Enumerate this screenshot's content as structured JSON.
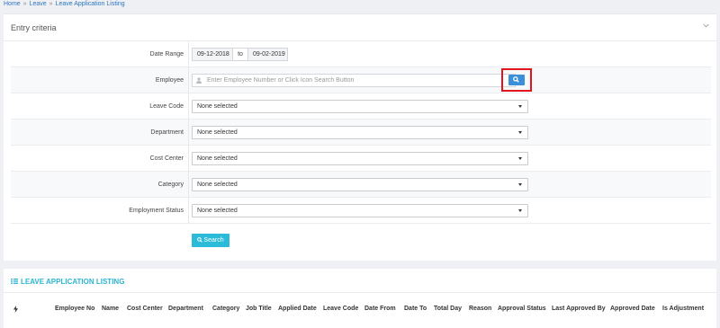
{
  "breadcrumb": {
    "home": "Home",
    "leave": "Leave",
    "current": "Leave Application Listing",
    "separator": "»"
  },
  "entry": {
    "title": "Entry criteria",
    "date_range": {
      "label": "Date Range",
      "from": "09-12-2018",
      "to_label": "to",
      "to": "09-02-2019"
    },
    "employee": {
      "label": "Employee",
      "placeholder": "Enter Employee Number or Click Icon Search Button"
    },
    "leave_code": {
      "label": "Leave Code",
      "value": "None selected"
    },
    "department": {
      "label": "Department",
      "value": "None selected"
    },
    "cost_center": {
      "label": "Cost Center",
      "value": "None selected"
    },
    "category": {
      "label": "Category",
      "value": "None selected"
    },
    "employment_status": {
      "label": "Employment Status",
      "value": "None selected"
    },
    "search_label": "Search"
  },
  "listing": {
    "title": "LEAVE APPLICATION LISTING",
    "columns": [
      "Employee No",
      "Name",
      "Cost Center",
      "Department",
      "Category",
      "Job Title",
      "Applied Date",
      "Leave Code",
      "Date From",
      "Date To",
      "Total Day",
      "Reason",
      "Approval Status",
      "Last Approved By",
      "Approved Date",
      "Is Adjustment"
    ]
  },
  "colors": {
    "accent": "#2bbbd8",
    "link": "#2d76c1",
    "highlight": "#e4141c",
    "button": "#3a8fd8"
  },
  "icons": [
    "chevron-down-icon",
    "user-icon",
    "search-icon",
    "list-icon",
    "bolt-icon"
  ]
}
